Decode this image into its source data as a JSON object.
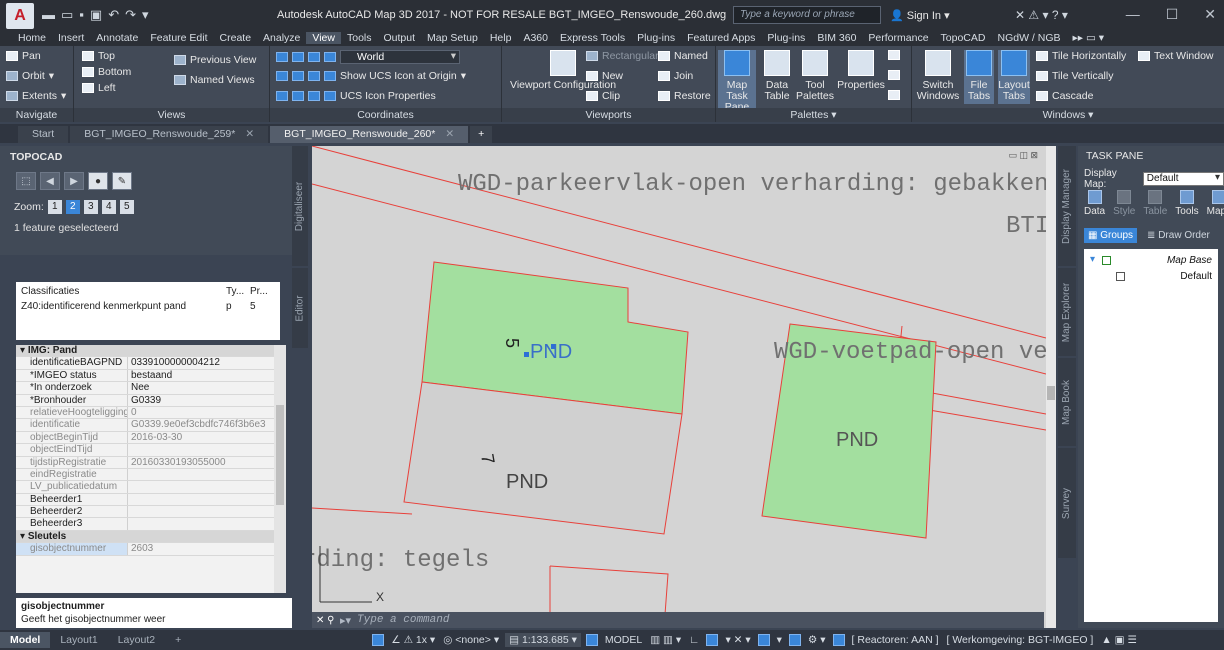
{
  "titlebar": {
    "title": "Autodesk AutoCAD Map 3D 2017 - NOT FOR RESALE    BGT_IMGEO_Renswoude_260.dwg",
    "search_placeholder": "Type a keyword or phrase",
    "sign_in": "Sign In",
    "app_letter": "A",
    "app_sub": "M3D"
  },
  "ribbon_tabs": [
    "Home",
    "Insert",
    "Annotate",
    "Feature Edit",
    "Create",
    "Analyze",
    "View",
    "Tools",
    "Output",
    "Map Setup",
    "Help",
    "A360",
    "Express Tools",
    "Plug-ins",
    "Featured Apps",
    "Plug-ins",
    "BIM 360",
    "Performance",
    "TopoCAD",
    "NGdW / NGB"
  ],
  "active_ribbon_tab": "View",
  "ribbon": {
    "navigate": {
      "pan": "Pan",
      "orbit": "Orbit",
      "extents": "Extents"
    },
    "views": {
      "top": "Top",
      "bottom": "Bottom",
      "left": "Left",
      "previous": "Previous View",
      "named": "Named Views"
    },
    "coordinates": {
      "ucs_combo": "World",
      "show_ucs": "Show UCS Icon at Origin",
      "ucs_props": "UCS Icon Properties"
    },
    "viewports": {
      "config": "Viewport Configuration",
      "rectangular": "Rectangular",
      "new": "New",
      "clip": "Clip",
      "named": "Named",
      "join": "Join",
      "restore": "Restore"
    },
    "palettes": {
      "map_task_pane": "Map Task Pane",
      "data_table": "Data Table",
      "tool_palettes": "Tool Palettes",
      "properties": "Properties"
    },
    "windows": {
      "switch": "Switch Windows",
      "file_tabs": "File Tabs",
      "layout_tabs": "Layout Tabs",
      "tile_h": "Tile Horizontally",
      "tile_v": "Tile Vertically",
      "cascade": "Cascade",
      "text_window": "Text Window"
    }
  },
  "ribbon_panel_labels": [
    "Navigate",
    "Views",
    "Coordinates",
    "Viewports",
    "Palettes ▾",
    "Windows ▾"
  ],
  "doc_tabs": [
    {
      "label": "Start",
      "active": false
    },
    {
      "label": "BGT_IMGEO_Renswoude_259*",
      "active": false
    },
    {
      "label": "BGT_IMGEO_Renswoude_260*",
      "active": true
    }
  ],
  "topocad": {
    "title": "TOPOCAD",
    "zoom_label": "Zoom:",
    "zoom_levels": [
      "1",
      "2",
      "3",
      "4",
      "5"
    ],
    "selected_zoom": "2",
    "feature_status": "1 feature geselecteerd",
    "vtab_digitaliseer": "Digitaliseer",
    "vtab_editor": "Editor"
  },
  "classificaties": {
    "headers": [
      "Classificaties",
      "Ty...",
      "Pr..."
    ],
    "rows": [
      [
        "Z40:identificerend kenmerkpunt pand",
        "p",
        "5"
      ]
    ]
  },
  "properties": {
    "section_main": "IMG: Pand",
    "rows": [
      {
        "k": "identificatieBAGPND",
        "v": "0339100000004212",
        "grey": false
      },
      {
        "k": "*IMGEO status",
        "v": "bestaand",
        "grey": false
      },
      {
        "k": "*In onderzoek",
        "v": "Nee",
        "grey": false
      },
      {
        "k": "*Bronhouder",
        "v": "G0339",
        "grey": false
      },
      {
        "k": "relatieveHoogteligging",
        "v": "0",
        "grey": true
      },
      {
        "k": "identificatie",
        "v": "G0339.9e0ef3cbdfc746f3b6e3",
        "grey": true
      },
      {
        "k": "objectBeginTijd",
        "v": "2016-03-30",
        "grey": true
      },
      {
        "k": "objectEindTijd",
        "v": "",
        "grey": true
      },
      {
        "k": "tijdstipRegistratie",
        "v": "20160330193055000",
        "grey": true
      },
      {
        "k": "eindRegistratie",
        "v": "",
        "grey": true
      },
      {
        "k": "LV_publicatiedatum",
        "v": "",
        "grey": true
      },
      {
        "k": "Beheerder1",
        "v": "",
        "grey": false
      },
      {
        "k": "Beheerder2",
        "v": "",
        "grey": false
      },
      {
        "k": "Beheerder3",
        "v": "",
        "grey": false
      }
    ],
    "section_keys": "Sleutels",
    "key_rows": [
      {
        "k": "gisobjectnummer",
        "v": "2603"
      }
    ]
  },
  "help": {
    "title": "gisobjectnummer",
    "text": "Geeft het gisobjectnummer weer"
  },
  "drawing": {
    "label_parkeer": "WGD-parkeervlak-open verharding: gebakken kl",
    "label_btd": "BTI",
    "label_voetpad": "WGD-voetpad-open ve",
    "label_tegels": "rding: tegels",
    "label_pnd1": "PND",
    "label_pnd2": "PND",
    "label_pnd3": "PND",
    "label_num5": "5",
    "label_num7": "7",
    "fill_green": "#a3df9f",
    "line_red": "#e8403a"
  },
  "command": {
    "placeholder": "Type a command"
  },
  "taskpane": {
    "title": "TASK PANE",
    "display_map_label": "Display Map:",
    "display_map_value": "Default",
    "icons": [
      "Data",
      "Style",
      "Table",
      "Tools",
      "Maps"
    ],
    "groups": "Groups",
    "draw_order": "Draw Order",
    "tree": [
      {
        "label": "Map Base",
        "italic": true
      },
      {
        "label": "Default",
        "italic": false
      }
    ],
    "vtabs": [
      "Display Manager",
      "Map Explorer",
      "Map Book",
      "Survey"
    ]
  },
  "status": {
    "tabs": [
      "Model",
      "Layout1",
      "Layout2"
    ],
    "scale": "1:133.685",
    "model": "MODEL",
    "none": "<none>",
    "reactoren": "[ Reactoren: AAN ]",
    "werkomgeving": "[ Werkomgeving: BGT-IMGEO ]"
  }
}
